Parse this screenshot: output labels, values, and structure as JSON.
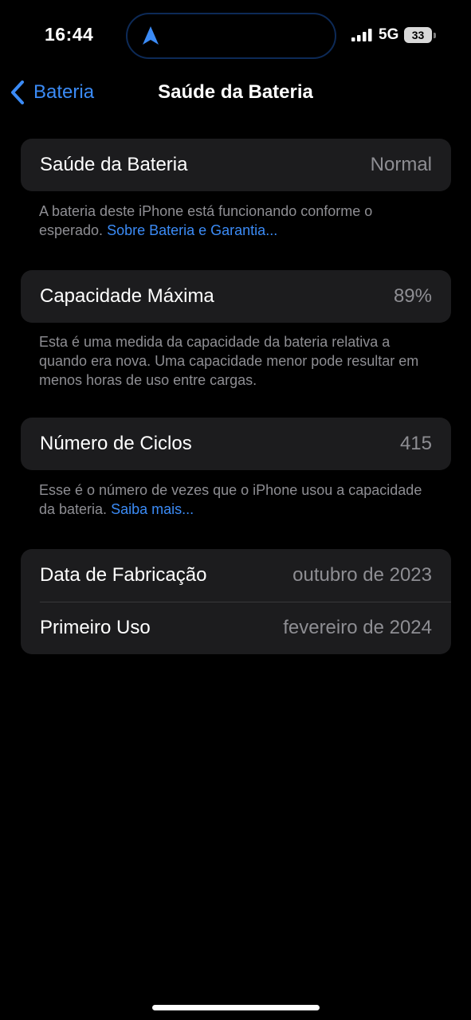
{
  "status_bar": {
    "time": "16:44",
    "network": "5G",
    "battery_level": "33",
    "icons": [
      "navigation-arrow-icon",
      "signal-icon",
      "battery-icon"
    ]
  },
  "nav": {
    "back_label": "Bateria",
    "title": "Saúde da Bateria"
  },
  "health": {
    "label": "Saúde da Bateria",
    "value": "Normal",
    "footnote": "A bateria deste iPhone está funcionando conforme o esperado.",
    "link": "Sobre Bateria e Garantia..."
  },
  "capacity": {
    "label": "Capacidade Máxima",
    "value": "89%",
    "footnote": "Esta é uma medida da capacidade da bateria relativa a quando era nova. Uma capacidade menor pode resultar em menos horas de uso entre cargas."
  },
  "cycles": {
    "label": "Número de Ciclos",
    "value": "415",
    "footnote": "Esse é o número de vezes que o iPhone usou a capacidade da bateria.",
    "link": "Saiba mais..."
  },
  "dates": {
    "manufacture_label": "Data de Fabricação",
    "manufacture_value": "outubro de 2023",
    "first_use_label": "Primeiro Uso",
    "first_use_value": "fevereiro de 2024"
  },
  "colors": {
    "background": "#000000",
    "cell": "#1c1c1e",
    "accent": "#3b8bf6",
    "secondary_text": "#8e8e93"
  }
}
